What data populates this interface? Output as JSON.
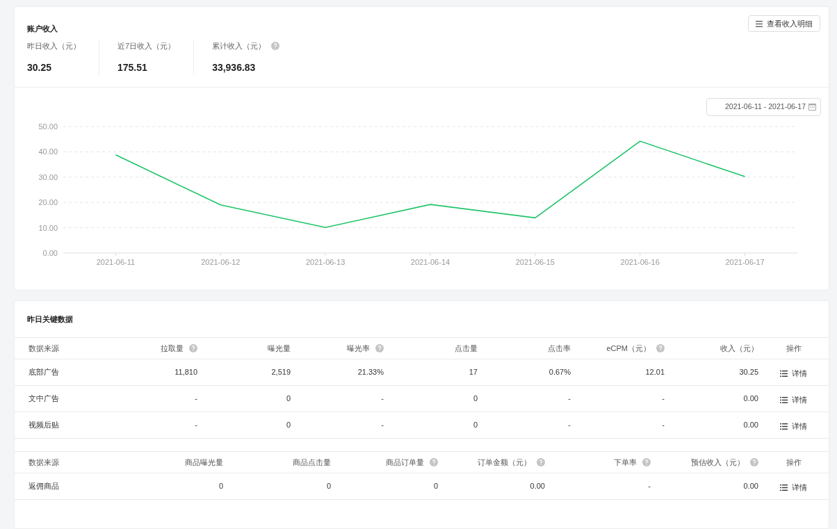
{
  "income": {
    "title": "账户收入",
    "detail_button": "查看收入明细",
    "stats": [
      {
        "label": "昨日收入（元）",
        "value": "30.25",
        "help": false
      },
      {
        "label": "近7日收入（元）",
        "value": "175.51",
        "help": false
      },
      {
        "label": "累计收入（元）",
        "value": "33,936.83",
        "help": true
      }
    ],
    "date_range": "2021-06-11 - 2021-06-17",
    "chart_data": {
      "type": "line",
      "categories": [
        "2021-06-11",
        "2021-06-12",
        "2021-06-13",
        "2021-06-14",
        "2021-06-15",
        "2021-06-16",
        "2021-06-17"
      ],
      "grid": true,
      "series": [
        {
          "color": "#1ec467",
          "values": [
            38.8,
            19.0,
            10.1,
            19.2,
            13.9,
            44.2,
            30.2
          ]
        }
      ],
      "ylim": [
        0,
        50
      ],
      "yticks": [
        {
          "value": 0,
          "label": "0.00"
        },
        {
          "value": 10,
          "label": "10.00"
        },
        {
          "value": 20,
          "label": "20.00"
        },
        {
          "value": 30,
          "label": "30.00"
        },
        {
          "value": 40,
          "label": "40.00"
        },
        {
          "value": 50,
          "label": "50.00"
        }
      ]
    }
  },
  "key_data": {
    "title": "昨日关键数据",
    "tables": [
      {
        "columns": [
          {
            "label": "数据来源",
            "help": false
          },
          {
            "label": "拉取量",
            "help": true
          },
          {
            "label": "曝光量",
            "help": false
          },
          {
            "label": "曝光率",
            "help": true
          },
          {
            "label": "点击量",
            "help": false
          },
          {
            "label": "点击率",
            "help": false
          },
          {
            "label": "eCPM（元）",
            "help": true
          },
          {
            "label": "收入（元）",
            "help": false
          },
          {
            "label": "操作",
            "help": false
          }
        ],
        "rows": [
          {
            "cells": [
              "底部广告",
              "11,810",
              "2,519",
              "21.33%",
              "17",
              "0.67%",
              "12.01",
              "30.25"
            ],
            "action": "详情"
          },
          {
            "cells": [
              "文中广告",
              "-",
              "0",
              "-",
              "0",
              "-",
              "-",
              "0.00"
            ],
            "action": "详情"
          },
          {
            "cells": [
              "视频后贴",
              "-",
              "0",
              "-",
              "0",
              "-",
              "-",
              "0.00"
            ],
            "action": "详情"
          }
        ]
      },
      {
        "columns": [
          {
            "label": "数据来源",
            "help": false
          },
          {
            "label": "商品曝光量",
            "help": false
          },
          {
            "label": "商品点击量",
            "help": false
          },
          {
            "label": "商品订单量",
            "help": true
          },
          {
            "label": "订单金额（元）",
            "help": true
          },
          {
            "label": "下单率",
            "help": true
          },
          {
            "label": "预估收入（元）",
            "help": true
          },
          {
            "label": "操作",
            "help": false
          }
        ],
        "rows": [
          {
            "cells": [
              "返佣商品",
              "0",
              "0",
              "0",
              "0.00",
              "-",
              "0.00"
            ],
            "action": "详情"
          }
        ]
      }
    ]
  }
}
